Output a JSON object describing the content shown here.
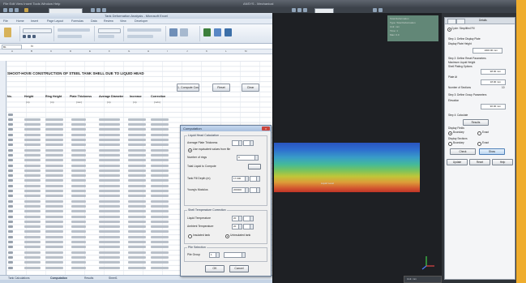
{
  "top": {
    "menu": "File  Edit  View  Insert  Tools  Window  Help",
    "title": "ANSYS - Mechanical"
  },
  "excel": {
    "title": "Tank Deformation Analysis - Microsoft Excel",
    "tabs": [
      "File",
      "Home",
      "Insert",
      "Page Layout",
      "Formulas",
      "Data",
      "Review",
      "View",
      "Developer"
    ],
    "name_box": "B1",
    "fx": "fx",
    "columns": [
      "A",
      "B",
      "C",
      "D",
      "E",
      "F",
      "G",
      "H",
      "I",
      "J",
      "K",
      "L",
      "M"
    ],
    "sheet_title": "SHOOT-HOVE CONSTRUCTION OF STEEL TANK SHELL DUE TO LIQUID HEAD",
    "buttons": {
      "compute": "1. Compute Cos",
      "reset": "Reset",
      "clear": "Clear"
    },
    "headers": [
      "No.",
      "Height",
      "Ring Height",
      "Plate Thickness",
      "Average Diameter",
      "Increase",
      "Correction"
    ],
    "units": [
      "",
      "(m)",
      "(m)",
      "(mm)",
      "(m)",
      "(m)",
      "(m/m)"
    ],
    "sheet_tabs": [
      "Tank Calculations",
      "Computation",
      "Results",
      "Sheet1"
    ]
  },
  "dialog": {
    "title": "Computation",
    "group1": "Liquid Head Calculation",
    "average_plate_thickness": "Average Plate Thickness",
    "use_equivalent": "Use equivalent values from file",
    "number_of_rings": "Number of rings",
    "ring_count": "9",
    "total_liquid": "Total Liquid to Compute",
    "tank_fill": "Tank Fill Depth (m)",
    "tank_fill_val": "17.000",
    "youngs_modulus": "Young's Modulus",
    "youngs_val": "200000",
    "group2": "Shell Temperature Correction",
    "liquid_temp": "Liquid Temperature",
    "liquid_temp_val": "20",
    "ambient_temp": "Ambient Temperature",
    "ambient_temp_val": "20",
    "insulated": "Insulated tank",
    "uninsulated": "Uninsulated tank",
    "group3": "Pile Selection",
    "pile_group": "Pile Group",
    "pile_val": "1",
    "ok": "OK",
    "cancel": "Cancel"
  },
  "viewport": {
    "info_lines": [
      "Total Deformation",
      "Type: Total Deformation",
      "Unit: mm",
      "Time: 1",
      "Max: 0.0"
    ],
    "tank_label": "Liquid Level",
    "bottom_label": "Unit: mm"
  },
  "panel": {
    "title": "Details",
    "lines": [
      "Cycle: Simplified Fill",
      "Step 1: Define Display Plate",
      "Display Plate Height",
      "Step 2: Define Reset Parameters",
      "Maximum Liquid Height",
      "Shell Plating Options",
      "Plate At",
      "Number of Sections",
      "Step 3: Define Group Parameters",
      "Elevation",
      "Step 4: Calculate",
      "Display Fields",
      "Display Sections"
    ],
    "fields": [
      "1000.00 mm",
      "98.00 mm",
      "18.00 mm",
      "90.00 mm"
    ],
    "section_count": "10",
    "calc_button": "Results",
    "radios": [
      "Boundary",
      "Exact"
    ],
    "buttons": {
      "check": "Check",
      "show": "Show",
      "update": "Update",
      "reset": "Reset",
      "help": "Help"
    }
  }
}
